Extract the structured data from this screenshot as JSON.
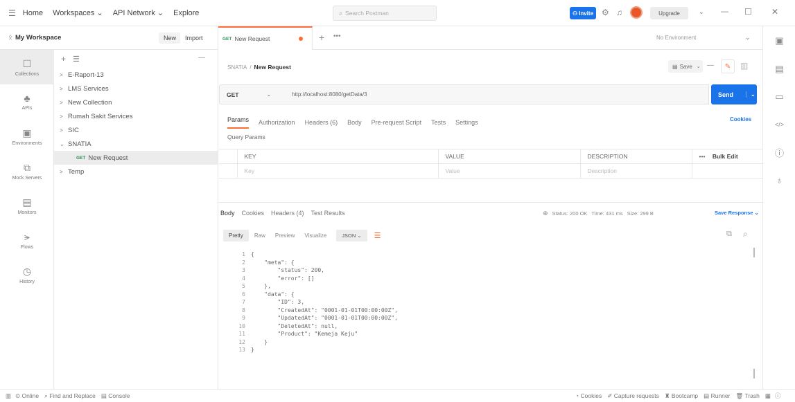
{
  "topbar": {
    "menu_icon": "menu-icon",
    "nav": [
      "Home",
      "Workspaces ⌄",
      "API Network ⌄",
      "Explore"
    ],
    "search_placeholder": "Search Postman",
    "invite_label": "Invite",
    "upgrade_label": "Upgrade",
    "window_controls": [
      "⌄",
      "—",
      "☐",
      "✕"
    ]
  },
  "workspace": {
    "name": "My Workspace",
    "new_label": "New",
    "import_label": "Import"
  },
  "rail": [
    {
      "icon": "collections-icon",
      "label": "Collections"
    },
    {
      "icon": "apis-icon",
      "label": "APIs"
    },
    {
      "icon": "environments-icon",
      "label": "Environments"
    },
    {
      "icon": "mock-servers-icon",
      "label": "Mock Servers"
    },
    {
      "icon": "monitors-icon",
      "label": "Monitors"
    },
    {
      "icon": "flows-icon",
      "label": "Flows"
    },
    {
      "icon": "history-icon",
      "label": "History"
    }
  ],
  "tree": [
    {
      "label": "E-Raport-13",
      "expanded": false,
      "indent": 0
    },
    {
      "label": "LMS Services",
      "expanded": false,
      "indent": 0
    },
    {
      "label": "New Collection",
      "expanded": false,
      "indent": 0
    },
    {
      "label": "Rumah Sakit Services",
      "expanded": false,
      "indent": 0
    },
    {
      "label": "SIC",
      "expanded": false,
      "indent": 0
    },
    {
      "label": "SNATIA",
      "expanded": true,
      "indent": 0
    },
    {
      "label": "New Request",
      "method": "GET",
      "indent": 1,
      "selected": true
    },
    {
      "label": "Temp",
      "expanded": false,
      "indent": 0
    }
  ],
  "tab": {
    "method": "GET",
    "label": "New Request",
    "environment": "No Environment"
  },
  "request": {
    "breadcrumb_parent": "SNATIA",
    "breadcrumb_sep": "/",
    "breadcrumb_name": "New Request",
    "save_label": "Save",
    "method": "GET",
    "url": "http://localhost:8080/getData/3",
    "send_label": "Send",
    "tabs": [
      "Params",
      "Authorization",
      "Headers (6)",
      "Body",
      "Pre-request Script",
      "Tests",
      "Settings"
    ],
    "cookies_label": "Cookies",
    "query_params_label": "Query Params",
    "columns": [
      "KEY",
      "VALUE",
      "DESCRIPTION"
    ],
    "placeholders": [
      "Key",
      "Value",
      "Description"
    ],
    "more_label": "•••",
    "bulk_edit_label": "Bulk Edit"
  },
  "response": {
    "tabs": [
      "Body",
      "Cookies",
      "Headers (4)",
      "Test Results"
    ],
    "status": "Status: 200 OK",
    "time": "Time: 431 ms",
    "size": "Size: 299 B",
    "save_response_label": "Save Response ⌄",
    "view_tabs": [
      "Pretty",
      "Raw",
      "Preview",
      "Visualize"
    ],
    "format": "JSON ⌄",
    "lines": [
      "{",
      "    \"meta\": {",
      "        \"status\": 200,",
      "        \"error\": []",
      "    },",
      "    \"data\": {",
      "        \"ID\": 3,",
      "        \"CreatedAt\": \"0001-01-01T00:00:00Z\",",
      "        \"UpdatedAt\": \"0001-01-01T00:00:00Z\",",
      "        \"DeletedAt\": null,",
      "        \"Product\": \"Kemeja Keju\"",
      "    }",
      "}"
    ]
  },
  "statusbar": {
    "online": "Online",
    "find_replace": "Find and Replace",
    "console": "Console",
    "cookies": "Cookies",
    "capture": "Capture requests",
    "bootcamp": "Bootcamp",
    "runner": "Runner",
    "trash": "Trash"
  },
  "colors": {
    "accent": "#ff6c37",
    "send": "#1a73e8",
    "get": "#2e8b57"
  }
}
